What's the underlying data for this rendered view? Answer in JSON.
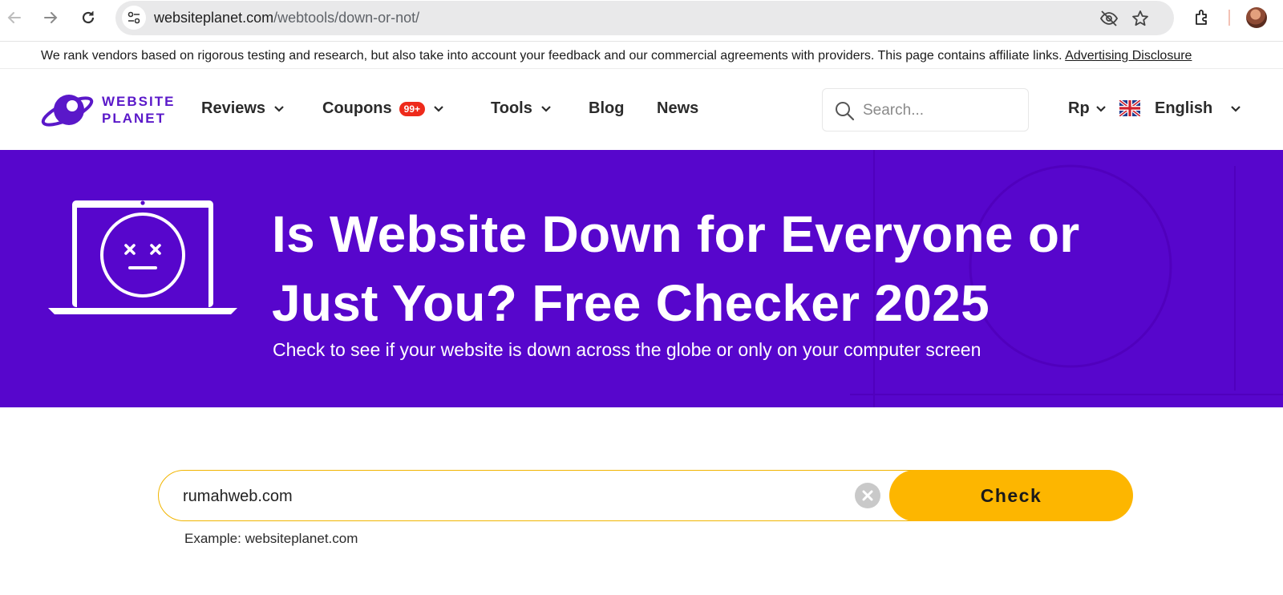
{
  "browser": {
    "url_domain": "websiteplanet.com",
    "url_path": "/webtools/down-or-not/",
    "icons": [
      "back-arrow-icon",
      "forward-arrow-icon",
      "reload-icon",
      "site-info-icon",
      "eye-off-icon",
      "star-icon",
      "extensions-icon",
      "profile-avatar"
    ]
  },
  "disclosure": {
    "text": "We rank vendors based on rigorous testing and research, but also take into account your feedback and our commercial agreements with providers. This page contains affiliate links.",
    "link": "Advertising Disclosure"
  },
  "header": {
    "logo_line1": "WEBSITE",
    "logo_line2": "PLANET",
    "menu": {
      "reviews": "Reviews",
      "coupons": "Coupons",
      "coupons_badge": "99+",
      "tools": "Tools",
      "blog": "Blog",
      "news": "News"
    },
    "search_placeholder": "Search...",
    "currency": "Rp",
    "language": "English"
  },
  "hero": {
    "title_line1": "Is Website Down for Everyone or",
    "title_line2": "Just You? Free Checker 2025",
    "subtitle": "Check to see if your website is down across the globe or only on your computer screen"
  },
  "checker": {
    "input_value": "rumahweb.com",
    "button_label": "Check",
    "example": "Example: websiteplanet.com"
  },
  "colors": {
    "brand_purple": "#5706cc",
    "check_button": "#fdb600",
    "badge_red": "#ee2a1b"
  }
}
